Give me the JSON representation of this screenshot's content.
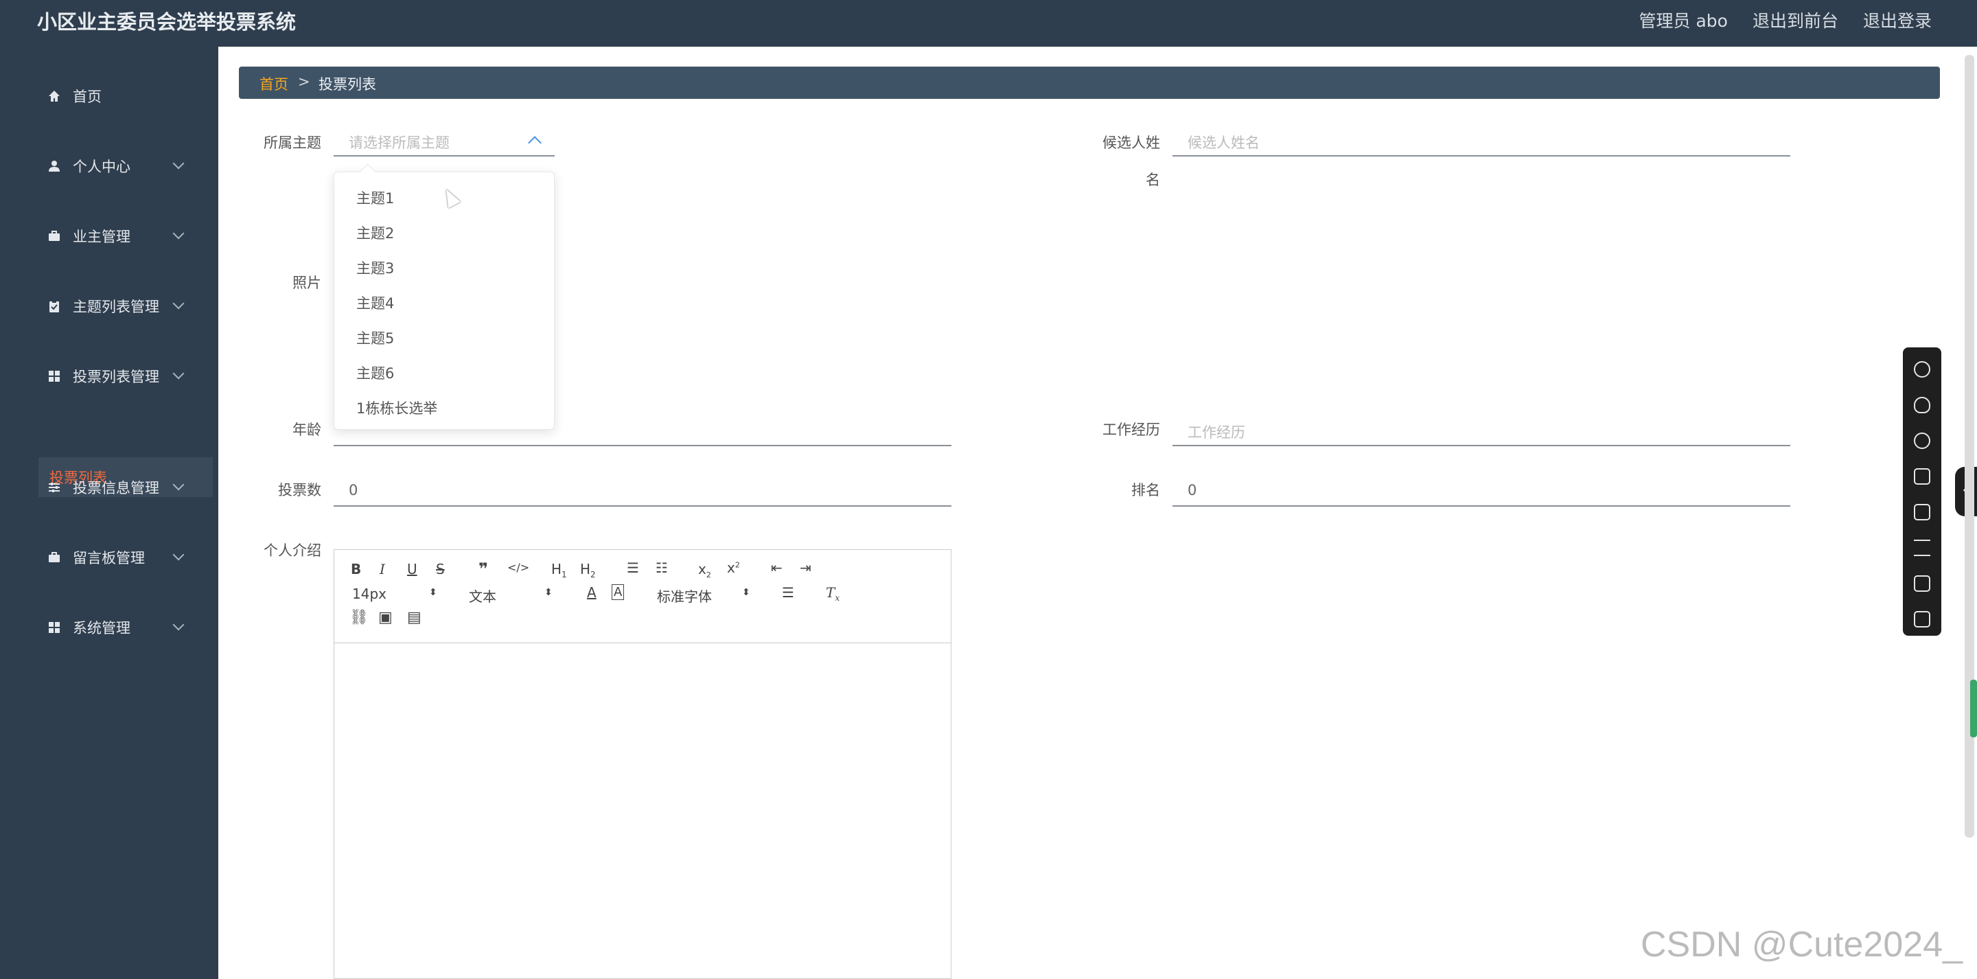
{
  "header": {
    "title": "小区业主委员会选举投票系统",
    "user": "管理员 abo",
    "exit_front": "退出到前台",
    "logout": "退出登录"
  },
  "sidebar": {
    "items": [
      {
        "label": "首页",
        "icon": "home-icon"
      },
      {
        "label": "个人中心",
        "icon": "user-icon"
      },
      {
        "label": "业主管理",
        "icon": "briefcase-icon"
      },
      {
        "label": "主题列表管理",
        "icon": "clipboard-icon"
      },
      {
        "label": "投票列表管理",
        "icon": "grid-icon"
      },
      {
        "label": "投票信息管理",
        "icon": "sliders-icon"
      },
      {
        "label": "留言板管理",
        "icon": "briefcase-icon"
      },
      {
        "label": "系统管理",
        "icon": "grid-icon"
      }
    ],
    "active_sub": "投票列表"
  },
  "breadcrumb": {
    "home": "首页",
    "separator": ">",
    "current": "投票列表"
  },
  "form": {
    "topic_label": "所属主题",
    "topic_placeholder": "请选择所属主题",
    "candidate_label_1": "候选人姓",
    "candidate_label_2": "名",
    "candidate_placeholder": "候选人姓名",
    "photo_label": "照片",
    "age_label": "年龄",
    "work_label": "工作经历",
    "work_placeholder": "工作经历",
    "votes_label": "投票数",
    "votes_value": "0",
    "rank_label": "排名",
    "rank_value": "0",
    "intro_label": "个人介绍"
  },
  "dropdown": {
    "options": [
      "主题1",
      "主题2",
      "主题3",
      "主题4",
      "主题5",
      "主题6",
      "1栋栋长选举"
    ]
  },
  "editor": {
    "font_size": "14px",
    "heading": "文本",
    "font_family": "标准字体"
  },
  "watermark": "CSDN @Cute2024_",
  "colors": {
    "sidebar_bg": "#2f3e4e",
    "active_sub": "#f06a3c",
    "breadcrumb_home": "#f5a623"
  }
}
